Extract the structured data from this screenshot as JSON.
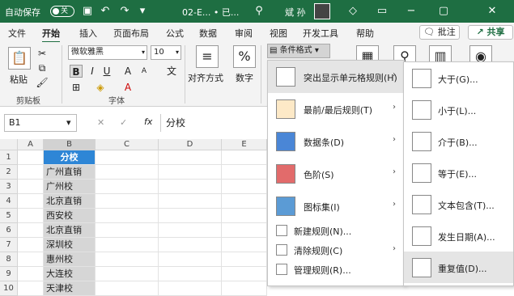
{
  "titlebar": {
    "autosave": "自动保存",
    "toggle": "关",
    "filename": "02-E... • 已...",
    "user": "斌 孙"
  },
  "menubar": {
    "items": [
      "文件",
      "开始",
      "插入",
      "页面布局",
      "公式",
      "数据",
      "审阅",
      "视图",
      "开发工具",
      "帮助"
    ],
    "comment": "批注",
    "share": "共享"
  },
  "ribbon": {
    "paste": "粘贴",
    "font_name": "微软雅黑",
    "font_size": "10",
    "bold": "B",
    "italic": "I",
    "underline": "U",
    "align": "对齐方式",
    "number": "数字",
    "number_symbol": "%",
    "cond_format": "条件格式",
    "group_clipboard": "剪贴板",
    "group_font": "字体"
  },
  "formula_bar": {
    "namebox": "B1",
    "fx": "fx",
    "value": "分校"
  },
  "grid": {
    "columns": [
      "A",
      "B",
      "C",
      "D",
      "E"
    ],
    "rows": [
      "1",
      "2",
      "3",
      "4",
      "5",
      "6",
      "7",
      "8",
      "9",
      "10"
    ],
    "b_values": [
      "分校",
      "广州直销",
      "广州校",
      "北京直销",
      "西安校",
      "北京直销",
      "深圳校",
      "惠州校",
      "大连校",
      "天津校"
    ]
  },
  "cf_menu": {
    "items": [
      {
        "label": "突出显示单元格规则(H)",
        "arrow": "›"
      },
      {
        "label": "最前/最后规则(T)",
        "arrow": "›"
      },
      {
        "label": "数据条(D)",
        "arrow": "›"
      },
      {
        "label": "色阶(S)",
        "arrow": "›"
      },
      {
        "label": "图标集(I)",
        "arrow": "›"
      },
      {
        "label": "新建规则(N)..."
      },
      {
        "label": "清除规则(C)",
        "arrow": "›"
      },
      {
        "label": "管理规则(R)..."
      }
    ]
  },
  "sub_menu": {
    "items": [
      {
        "label": "大于(G)..."
      },
      {
        "label": "小于(L)..."
      },
      {
        "label": "介于(B)..."
      },
      {
        "label": "等于(E)..."
      },
      {
        "label": "文本包含(T)..."
      },
      {
        "label": "发生日期(A)..."
      },
      {
        "label": "重复值(D)..."
      }
    ]
  },
  "colors": {
    "accent": "#1e6e42",
    "header_fill": "#2e86d6",
    "hover": "#e5e5e5"
  }
}
